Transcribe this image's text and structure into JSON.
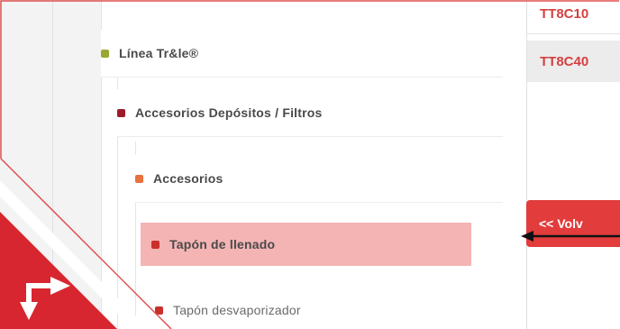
{
  "tree": {
    "items": [
      {
        "label": "Línea Tr&le®",
        "level": 1,
        "dot_color": "#9aa832"
      },
      {
        "label": "Accesorios Depósitos / Filtros",
        "level": 2,
        "dot_color": "#9c1a2a"
      },
      {
        "label": "Accesorios",
        "level": 3,
        "dot_color": "#e8713c"
      },
      {
        "label": "Tapón de llenado",
        "level": 4,
        "dot_color": "#c9302c",
        "selected": true
      },
      {
        "label": "Tapón desvaporizador",
        "level": 5,
        "dot_color": "#c9302c"
      }
    ]
  },
  "products": {
    "codes": [
      "TT8C10",
      "TT8C40"
    ]
  },
  "actions": {
    "back_label": "<< Volv"
  },
  "colors": {
    "accent": "#e23c3c",
    "selected_bg": "#f4b4b4",
    "code_text": "#d63f3f",
    "badge": "#d7262f"
  },
  "icons": {
    "corner": "turn-arrow-icon",
    "pointer": "arrow-left-icon"
  }
}
